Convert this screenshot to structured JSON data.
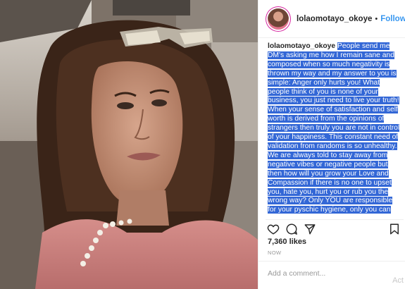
{
  "post": {
    "username": "lolaomotayo_okoye",
    "follow_label": "Follow",
    "separator": "•",
    "caption_user": "lolaomotayo_okoye",
    "caption_text": "People send me DM's asking me how I remain sane and composed when so much negativity is thrown my way and my answer to you is simple: Anger only hurts you! What people think of you is none of your business, you just need to live your truth! When your sense of satisfaction and self worth is derived from the opinions of strangers then truly you are not in control of your happiness. This constant need of validation from randoms is so unhealthy. We are always told to stay away from negative vibes or negative people but then how will you grow your Love and Compassion if there is no one to upset you, hate you, hurt you or rub you the wrong way? Only YOU are responsible for your pyschic hygiene, only you can clear and fill your energy with love and goodness everyday, no one can",
    "likes": "7,360 likes",
    "time": "NOW",
    "comment_placeholder": "Add a comment...",
    "watermark": "Act"
  },
  "icons": {
    "like": "heart-icon",
    "comment": "comment-icon",
    "share": "share-icon",
    "save": "bookmark-icon"
  },
  "colors": {
    "link": "#3897f0",
    "selection": "#3367d6",
    "text": "#262626",
    "muted": "#999999"
  }
}
